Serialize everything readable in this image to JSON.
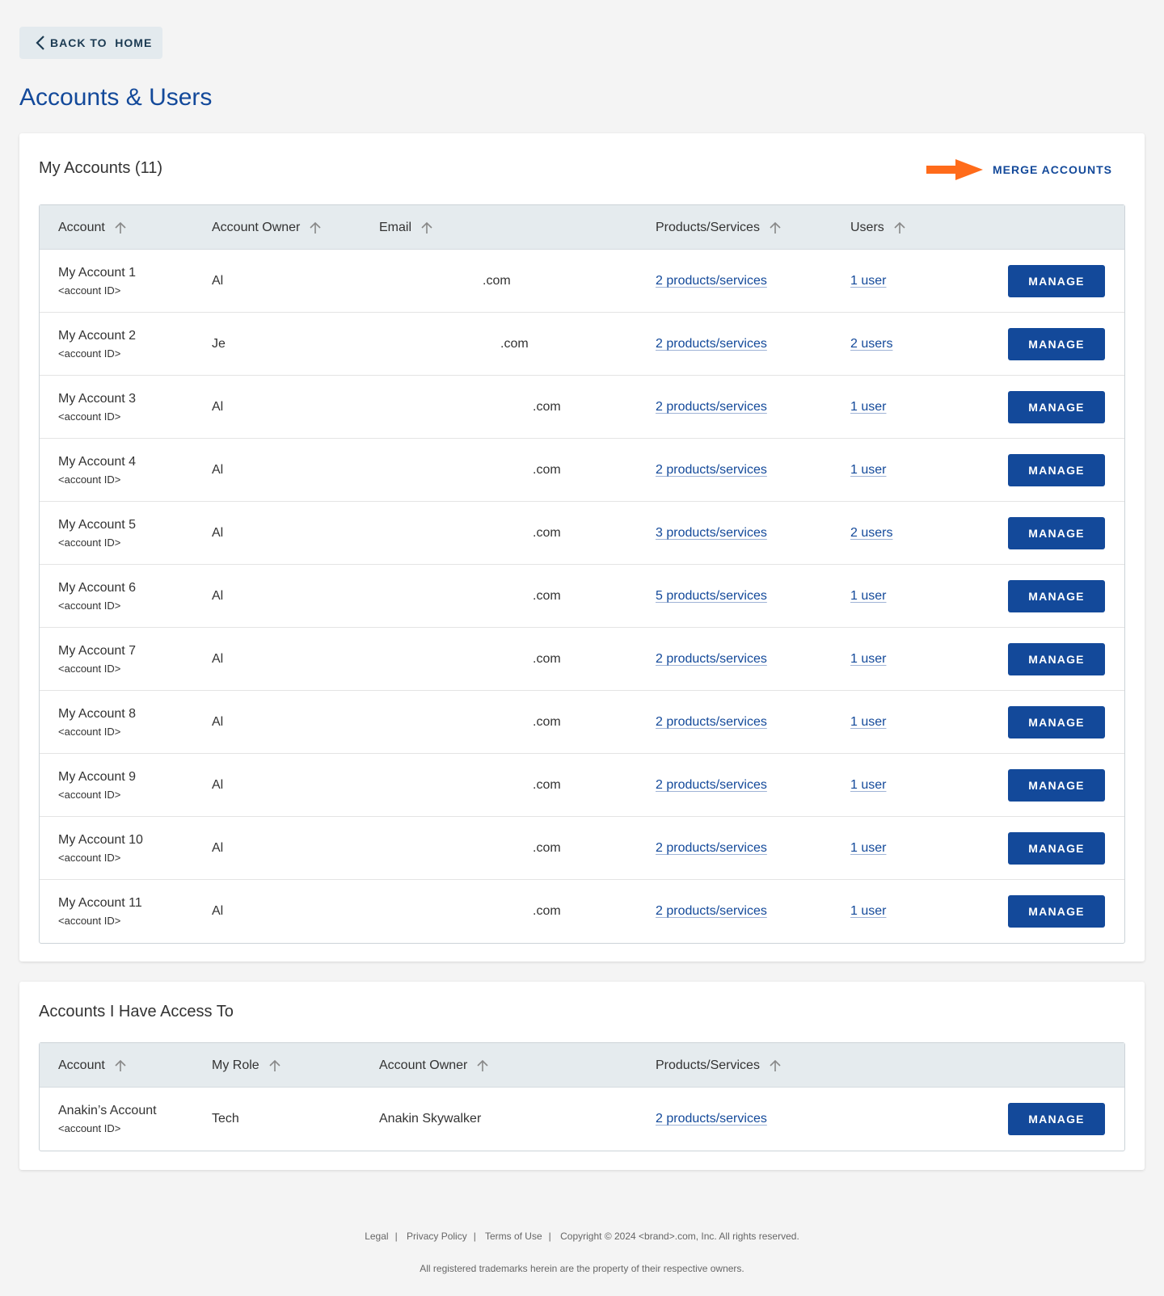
{
  "back_label": "BACK TO  HOME",
  "page_title": "Accounts & Users",
  "my_accounts": {
    "title": "My Accounts (11)",
    "merge_label": "MERGE ACCOUNTS",
    "arrow_color": "#ff6b1a",
    "columns": [
      "Account",
      "Account Owner",
      "Email",
      "Products/Services",
      "Users"
    ],
    "rows": [
      {
        "name": "My Account 1",
        "id": "<account ID>",
        "owner": "Al",
        "email": ".com",
        "products": "2 products/services",
        "users": "1 user",
        "action": "MANAGE"
      },
      {
        "name": "My Account 2",
        "id": "<account ID>",
        "owner": "Je",
        "email": ".com",
        "products": "2 products/services",
        "users": "2 users",
        "action": "MANAGE"
      },
      {
        "name": "My Account 3",
        "id": "<account ID>",
        "owner": "Al",
        "email": ".com",
        "products": "2 products/services",
        "users": "1 user",
        "action": "MANAGE"
      },
      {
        "name": "My Account 4",
        "id": "<account ID>",
        "owner": "Al",
        "email": ".com",
        "products": "2 products/services",
        "users": "1 user",
        "action": "MANAGE"
      },
      {
        "name": "My Account 5",
        "id": "<account ID>",
        "owner": "Al",
        "email": ".com",
        "products": "3 products/services",
        "users": "2 users",
        "action": "MANAGE"
      },
      {
        "name": "My Account 6",
        "id": "<account ID>",
        "owner": "Al",
        "email": ".com",
        "products": "5 products/services",
        "users": "1 user",
        "action": "MANAGE"
      },
      {
        "name": "My Account 7",
        "id": "<account ID>",
        "owner": "Al",
        "email": ".com",
        "products": "2 products/services",
        "users": "1 user",
        "action": "MANAGE"
      },
      {
        "name": "My Account 8",
        "id": "<account ID>",
        "owner": "Al",
        "email": ".com",
        "products": "2 products/services",
        "users": "1 user",
        "action": "MANAGE"
      },
      {
        "name": "My Account 9",
        "id": "<account ID>",
        "owner": "Al",
        "email": ".com",
        "products": "2 products/services",
        "users": "1 user",
        "action": "MANAGE"
      },
      {
        "name": "My Account 10",
        "id": "<account ID>",
        "owner": "Al",
        "email": ".com",
        "products": "2 products/services",
        "users": "1 user",
        "action": "MANAGE"
      },
      {
        "name": "My Account 11",
        "id": "<account ID>",
        "owner": "Al",
        "email": ".com",
        "products": "2 products/services",
        "users": "1 user",
        "action": "MANAGE"
      }
    ]
  },
  "access_accounts": {
    "title": "Accounts I Have Access To",
    "columns": [
      "Account",
      "My Role",
      "Account Owner",
      "Products/Services"
    ],
    "rows": [
      {
        "name": "Anakin’s Account",
        "id": "<account ID>",
        "role": "Tech",
        "owner": "Anakin Skywalker",
        "products": "2 products/services",
        "action": "MANAGE"
      }
    ]
  },
  "footer": {
    "links": [
      "Legal",
      "Privacy Policy",
      "Terms of Use"
    ],
    "copyright": "Copyright © 2024 <brand>.com, Inc. All rights reserved.",
    "trademark": "All registered trademarks herein are the property of their respective owners."
  }
}
